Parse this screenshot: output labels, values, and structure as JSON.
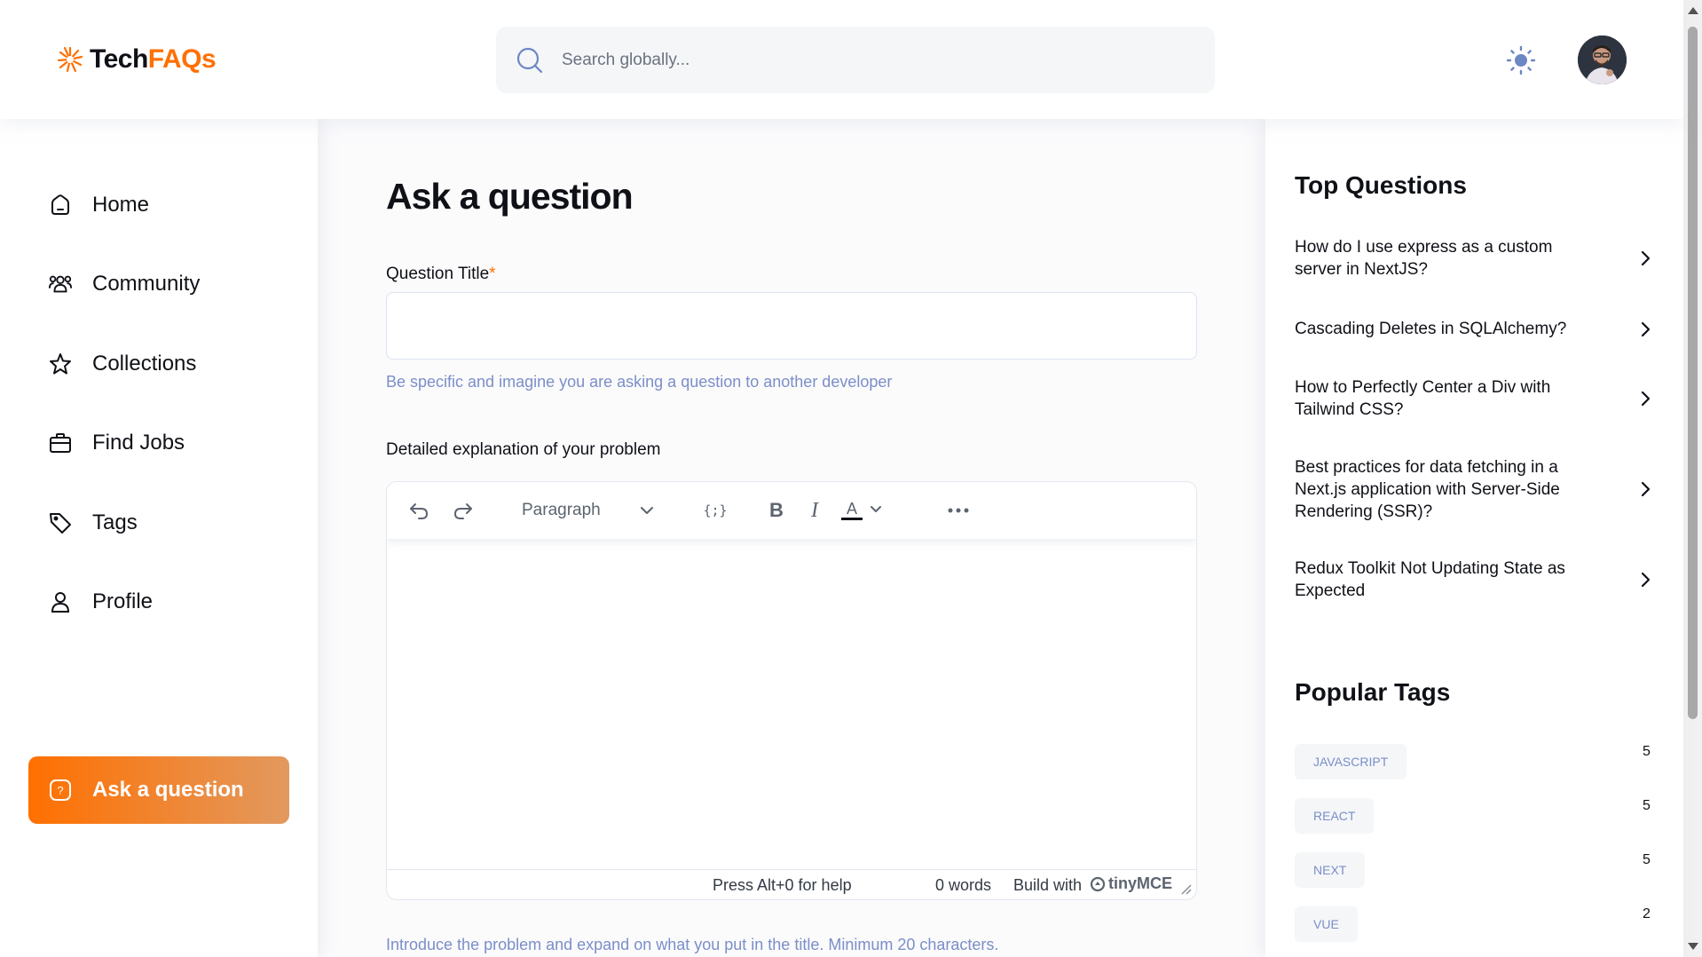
{
  "brand": {
    "name_part1": "Tech",
    "name_part2": "FAQs",
    "accent_color": "#ff7000"
  },
  "search": {
    "placeholder": "Search globally..."
  },
  "header": {
    "theme_icon": "sun-icon",
    "avatar_alt": "User avatar"
  },
  "sidebar": {
    "items": [
      {
        "label": "Home",
        "icon": "home-icon"
      },
      {
        "label": "Community",
        "icon": "users-icon"
      },
      {
        "label": "Collections",
        "icon": "star-icon"
      },
      {
        "label": "Find Jobs",
        "icon": "briefcase-icon"
      },
      {
        "label": "Tags",
        "icon": "tag-icon"
      },
      {
        "label": "Profile",
        "icon": "user-icon"
      },
      {
        "label": "Ask a question",
        "icon": "question-icon",
        "active": true
      }
    ]
  },
  "main": {
    "title": "Ask a question",
    "question_title_label": "Question Title",
    "required_mark": "*",
    "question_title_value": "",
    "question_title_hint": "Be specific and imagine you are asking a question to another developer",
    "explanation_label": "Detailed explanation of your problem",
    "explanation_hint": "Introduce the problem and expand on what you put in the title. Minimum 20 characters."
  },
  "editor": {
    "block_format": "Paragraph",
    "status_help": "Press Alt+0 for help",
    "status_words": "0 words",
    "status_build": "Build with",
    "status_brand": "tinyMCE"
  },
  "right_sidebar": {
    "top_questions_heading": "Top Questions",
    "top_questions": [
      "How do I use express as a custom server in NextJS?",
      "Cascading Deletes in SQLAlchemy?",
      "How to Perfectly Center a Div with Tailwind CSS?",
      "Best practices for data fetching in a Next.js application with Server-Side Rendering (SSR)?",
      "Redux Toolkit Not Updating State as Expected"
    ],
    "popular_tags_heading": "Popular Tags",
    "popular_tags": [
      {
        "name": "JAVASCRIPT",
        "count": "5"
      },
      {
        "name": "REACT",
        "count": "5"
      },
      {
        "name": "NEXT",
        "count": "5"
      },
      {
        "name": "VUE",
        "count": "2"
      }
    ]
  }
}
